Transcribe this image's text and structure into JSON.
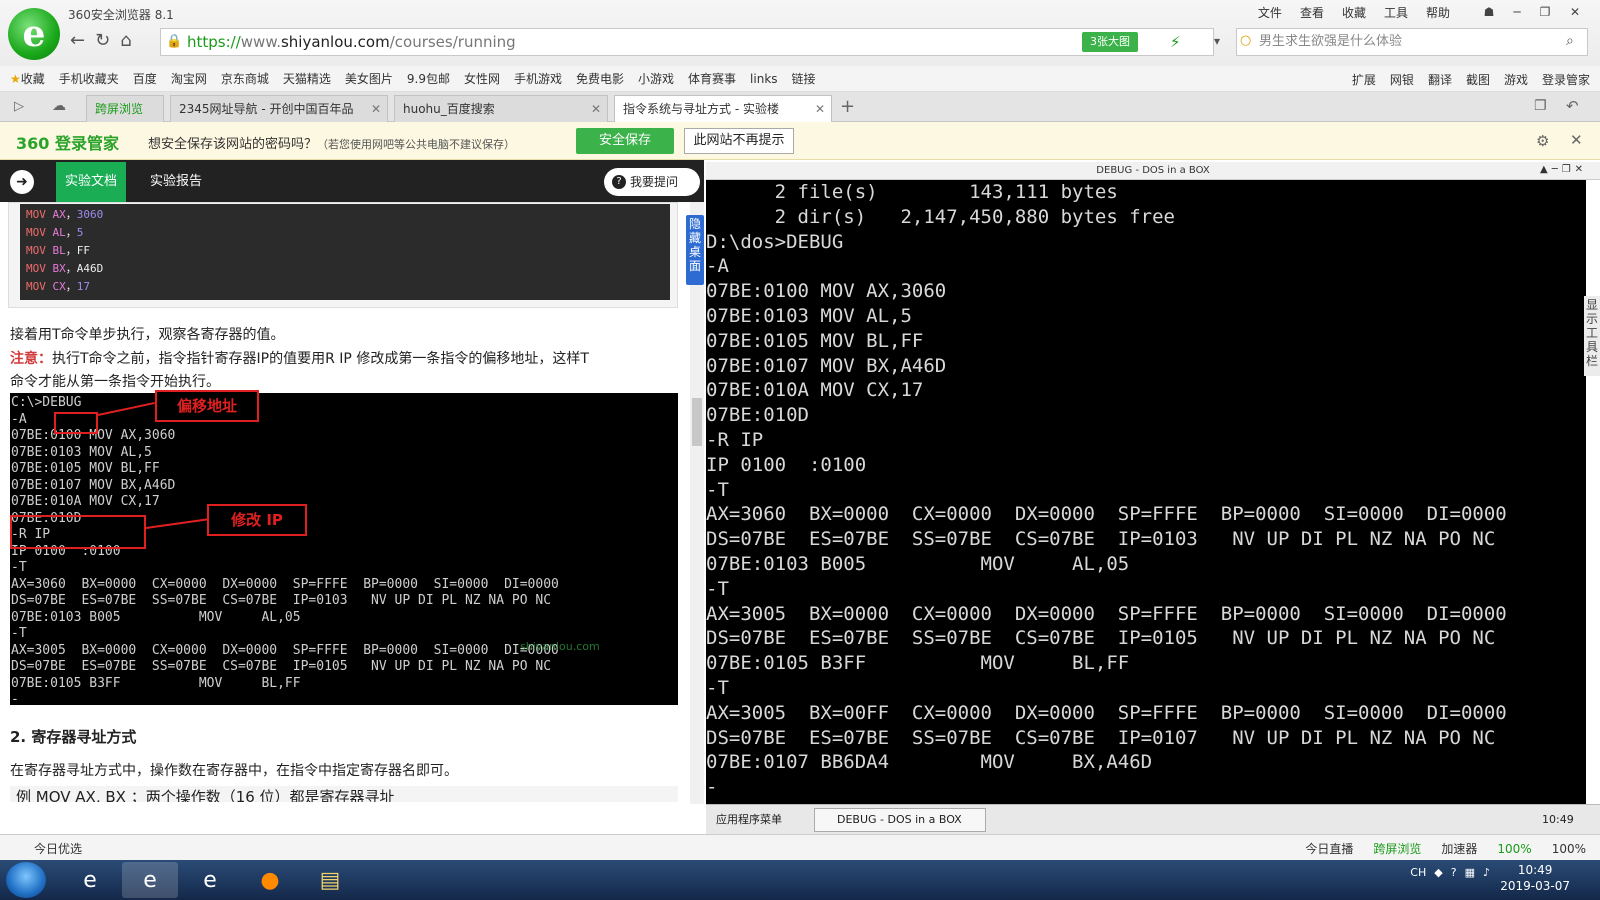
{
  "browser": {
    "app_title": "360安全浏览器 8.1",
    "menu": [
      "文件",
      "查看",
      "收藏",
      "工具",
      "帮助"
    ],
    "url_scheme": "https://",
    "url_pre": "www.",
    "url_domain": "shiyanlou.com",
    "url_path": "/courses/running",
    "badge": "3张大图",
    "search_placeholder": "男生求生欲强是什么体验"
  },
  "bookmarks": {
    "left": [
      "收藏",
      "手机收藏夹",
      "百度",
      "淘宝网",
      "京东商城",
      "天猫精选",
      "美女图片",
      "9.9包邮",
      "女性网",
      "手机游戏",
      "免费电影",
      "小游戏",
      "体育赛事",
      "links",
      "链接"
    ],
    "right": [
      "扩展",
      "网银",
      "翻译",
      "截图",
      "游戏",
      "登录管家"
    ]
  },
  "tabs": [
    {
      "label": "跨屏浏览"
    },
    {
      "label": "2345网址导航 - 开创中国百年品"
    },
    {
      "label": "huohu_百度搜索"
    },
    {
      "label": "指令系统与寻址方式 - 实验楼"
    }
  ],
  "password_bar": {
    "brand": "360 登录管家",
    "message": "想安全保存该网站的密码吗？",
    "note": "（若您使用网吧等公共电脑不建议保存）",
    "save": "安全保存",
    "never": "此网站不再提示"
  },
  "lab": {
    "tab_doc": "实验文档",
    "tab_report": "实验报告",
    "ask": "我要提问",
    "hide_desktop": "隐藏桌面",
    "code_lines": [
      {
        "op": "MOV",
        "reg": "AX",
        "val": "3060",
        "cls": "num"
      },
      {
        "op": "MOV",
        "reg": "AL",
        "val": "5",
        "cls": "num"
      },
      {
        "op": "MOV",
        "reg": "BL",
        "val": "FF",
        "cls": "hex"
      },
      {
        "op": "MOV",
        "reg": "BX",
        "val": "A46D",
        "cls": "hex"
      },
      {
        "op": "MOV",
        "reg": "CX",
        "val": "17",
        "cls": "num"
      }
    ],
    "para1": "接着用T命令单步执行，观察各寄存器的值。",
    "note_label": "注意：",
    "note_text": "执行T命令之前，指令指针寄存器IP的值要用R IP 修改成第一条指令的偏移地址，这样T",
    "note_text2": "命令才能从第一条指令开始执行。",
    "ann_offset": "偏移地址",
    "ann_ip": "修改 IP",
    "watermark": "shiyanlou.com",
    "dos_image": [
      "C:\\>DEBUG",
      "-A",
      "07BE:0100 MOV AX,3060",
      "07BE:0103 MOV AL,5",
      "07BE:0105 MOV BL,FF",
      "07BE:0107 MOV BX,A46D",
      "07BE:010A MOV CX,17",
      "07BE:010D",
      "-R IP",
      "IP 0100  :0100",
      "-T",
      "AX=3060  BX=0000  CX=0000  DX=0000  SP=FFFE  BP=0000  SI=0000  DI=0000",
      "DS=07BE  ES=07BE  SS=07BE  CS=07BE  IP=0103   NV UP DI PL NZ NA PO NC",
      "07BE:0103 B005          MOV     AL,05",
      "-T",
      "AX=3005  BX=0000  CX=0000  DX=0000  SP=FFFE  BP=0000  SI=0000  DI=0000",
      "DS=07BE  ES=07BE  SS=07BE  CS=07BE  IP=0105   NV UP DI PL NZ NA PO NC",
      "07BE:0105 B3FF          MOV     BL,FF",
      "-"
    ],
    "section_heading": "2. 寄存器寻址方式",
    "para2": "在寄存器寻址方式中，操作数在寄存器中，在指令中指定寄存器名即可。",
    "para3": "例    MOV   AX,   BX         ；两个操作数（16 位）都是寄存器寻址"
  },
  "dosbox": {
    "title": "DEBUG - DOS in a BOX",
    "show_toolbar": "显示工具栏",
    "lines": [
      "      2 file(s)        143,111 bytes",
      "      2 dir(s)   2,147,450,880 bytes free",
      "D:\\dos>DEBUG",
      "-A",
      "07BE:0100 MOV AX,3060",
      "07BE:0103 MOV AL,5",
      "07BE:0105 MOV BL,FF",
      "07BE:0107 MOV BX,A46D",
      "07BE:010A MOV CX,17",
      "07BE:010D",
      "-R IP",
      "IP 0100  :0100",
      "-T",
      "AX=3060  BX=0000  CX=0000  DX=0000  SP=FFFE  BP=0000  SI=0000  DI=0000",
      "DS=07BE  ES=07BE  SS=07BE  CS=07BE  IP=0103   NV UP DI PL NZ NA PO NC",
      "07BE:0103 B005          MOV     AL,05",
      "-T",
      "AX=3005  BX=0000  CX=0000  DX=0000  SP=FFFE  BP=0000  SI=0000  DI=0000",
      "DS=07BE  ES=07BE  SS=07BE  CS=07BE  IP=0105   NV UP DI PL NZ NA PO NC",
      "07BE:0105 B3FF          MOV     BL,FF",
      "-T",
      "AX=3005  BX=00FF  CX=0000  DX=0000  SP=FFFE  BP=0000  SI=0000  DI=0000",
      "DS=07BE  ES=07BE  SS=07BE  CS=07BE  IP=0107   NV UP DI PL NZ NA PO NC",
      "07BE:0107 BB6DA4        MOV     BX,A46D",
      "-"
    ],
    "taskbar_start": "应用程序菜单",
    "taskbar_item": "DEBUG - DOS in a BOX",
    "clock": "10:49"
  },
  "statusbar": {
    "left": "今日优选",
    "right": [
      "今日直播",
      "跨屏浏览",
      "加速器",
      "100%",
      "100%"
    ]
  },
  "win_taskbar": {
    "tray_lang": "CH",
    "time": "10:49",
    "date": "2019-03-07"
  },
  "colors": {
    "green": "#1aad54",
    "brand": "#3bb24a",
    "annotation": "#e02020"
  }
}
